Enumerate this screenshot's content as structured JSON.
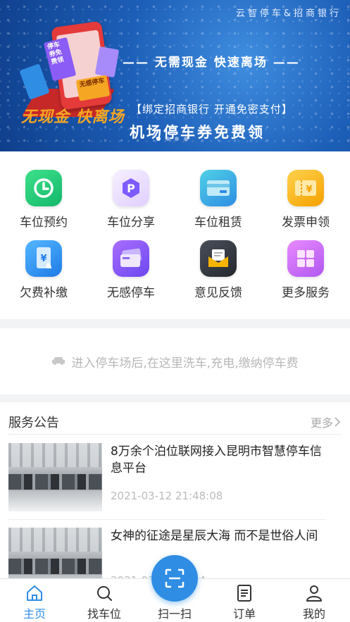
{
  "banner": {
    "brand": "云智停车&招商银行",
    "slogan": "—— 无需现金  快速离场 ——",
    "bind_text": "【绑定招商银行 开通免密支付】",
    "headline": "机场停车券免费领",
    "script_text": "无现金 快离场",
    "art_tickets": [
      "停车券免费领",
      "无感停车"
    ],
    "dots_total": 4,
    "dots_active": 0
  },
  "services": [
    {
      "label": "车位预约",
      "icon": "clock-icon"
    },
    {
      "label": "车位分享",
      "icon": "parking-p-icon"
    },
    {
      "label": "车位租赁",
      "icon": "card-icon"
    },
    {
      "label": "发票申领",
      "icon": "yen-ticket-icon"
    },
    {
      "label": "欠费补缴",
      "icon": "phone-pay-icon"
    },
    {
      "label": "无感停车",
      "icon": "contactless-card-icon"
    },
    {
      "label": "意见反馈",
      "icon": "mail-icon"
    },
    {
      "label": "更多服务",
      "icon": "grid-icon"
    }
  ],
  "tip": {
    "text": "进入停车场后,在这里洗车,充电,缴纳停车费",
    "icon": "car-icon"
  },
  "announcements": {
    "title": "服务公告",
    "more": "更多",
    "items": [
      {
        "title": "8万余个泊位联网接入昆明市智慧停车信息平台",
        "date": "2021-03-12 21:48:08"
      },
      {
        "title": "女神的征途是星辰大海 而不是世俗人间",
        "date": "2021-03-12 23:14"
      }
    ]
  },
  "tabs": [
    {
      "label": "主页",
      "icon": "home-icon",
      "active": true
    },
    {
      "label": "找车位",
      "icon": "search-icon",
      "active": false
    },
    {
      "label": "扫一扫",
      "icon": "scan-icon",
      "active": false
    },
    {
      "label": "订单",
      "icon": "order-list-icon",
      "active": false
    },
    {
      "label": "我的",
      "icon": "user-icon",
      "active": false
    }
  ],
  "colors": {
    "accent": "#2f8de4",
    "banner_blue": "#1d5fb8",
    "muted_text": "#b8b8b8"
  }
}
